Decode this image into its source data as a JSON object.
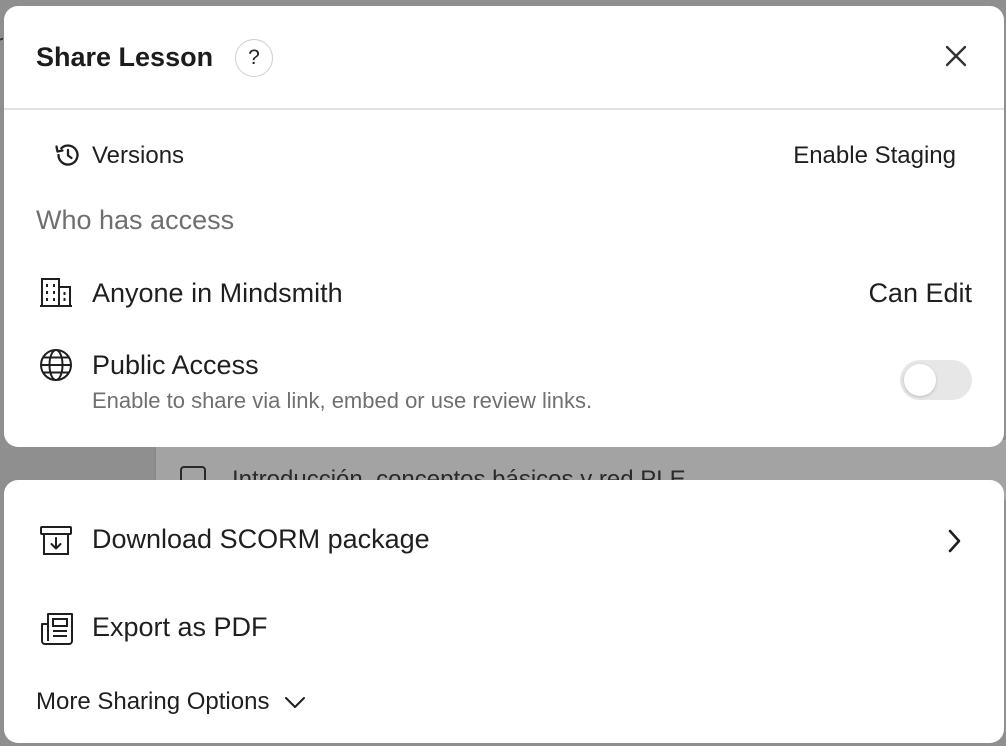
{
  "background": {
    "partial_list_item": "Introducción, conceptos básicos y red PLE"
  },
  "modal": {
    "title": "Share Lesson",
    "help_label": "?",
    "versions_label": "Versions",
    "enable_staging_label": "Enable Staging",
    "access_heading": "Who has access",
    "org_access": {
      "label": "Anyone in Mindsmith",
      "permission": "Can Edit"
    },
    "public_access": {
      "label": "Public Access",
      "description": "Enable to share via link, embed or use review links.",
      "enabled": false
    }
  },
  "export": {
    "scorm_label": "Download SCORM package",
    "pdf_label": "Export as PDF",
    "more_options_label": "More Sharing Options"
  },
  "colors": {
    "backdrop": "#8f8f8f",
    "card": "#ffffff",
    "muted_text": "#6f6f6f",
    "toggle_off": "#e7e7e7"
  }
}
